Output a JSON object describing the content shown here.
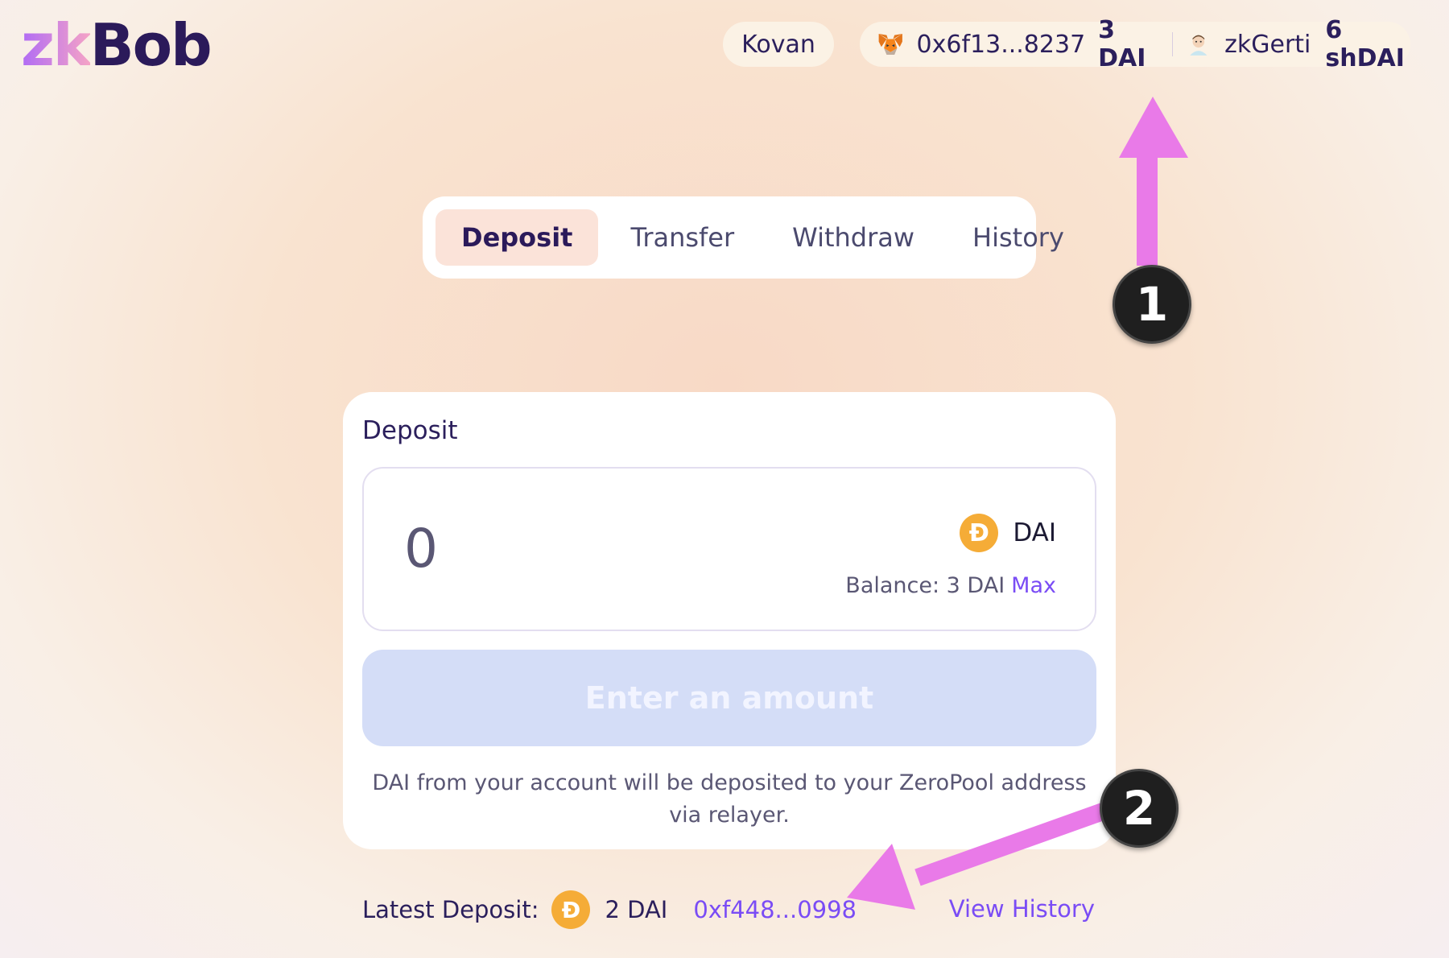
{
  "logo": {
    "zk": "zk",
    "bob": "Bob"
  },
  "header": {
    "network": "Kovan",
    "wallet_address": "0x6f13...8237",
    "wallet_balance": "3 DAI",
    "zk_account_name": "zkGerti",
    "zk_balance": "6 shDAI"
  },
  "tabs": [
    {
      "label": "Deposit",
      "active": true
    },
    {
      "label": "Transfer",
      "active": false
    },
    {
      "label": "Withdraw",
      "active": false
    },
    {
      "label": "History",
      "active": false
    }
  ],
  "deposit_card": {
    "title": "Deposit",
    "amount_value": "0",
    "token_symbol": "DAI",
    "balance_label": "Balance: 3 DAI",
    "max_label": "Max",
    "button_label": "Enter an amount",
    "note": "DAI from your account will be deposited to your ZeroPool address via relayer."
  },
  "latest_deposit": {
    "label": "Latest Deposit:",
    "amount": "2 DAI",
    "tx_hash": "0xf448...0998",
    "view_history": "View History"
  },
  "annotations": {
    "badge_1": "1",
    "badge_2": "2",
    "arrow_color": "#e97ae8"
  },
  "colors": {
    "accent": "#7a4cf5",
    "dai_coin": "#f5ac37",
    "button_disabled": "#d4ddf7",
    "active_tab": "#fbe3d9"
  },
  "icons": {
    "wallet": "metamask-fox-icon",
    "account": "user-avatar-icon",
    "token": "dai-coin-icon"
  }
}
